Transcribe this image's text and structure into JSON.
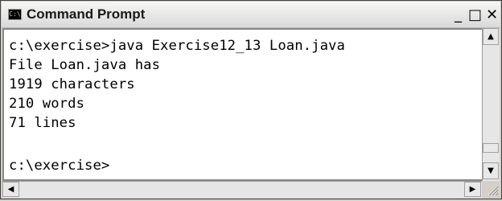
{
  "window": {
    "title": "Command Prompt",
    "icon_text": "C:\\",
    "controls": {
      "minimize": "_",
      "maximize": "□",
      "close": "✕"
    }
  },
  "console": {
    "lines": [
      "c:\\exercise>java Exercise12_13 Loan.java",
      "File Loan.java has",
      "1919 characters",
      "210 words",
      "71 lines",
      "",
      "c:\\exercise>"
    ]
  },
  "scrollbars": {
    "up_arrow": "▲",
    "down_arrow": "▼",
    "left_arrow": "◀",
    "right_arrow": "▶"
  },
  "colors": {
    "console_background": "#ffffff",
    "console_text": "#000000",
    "chrome": "#d4d0c8"
  }
}
